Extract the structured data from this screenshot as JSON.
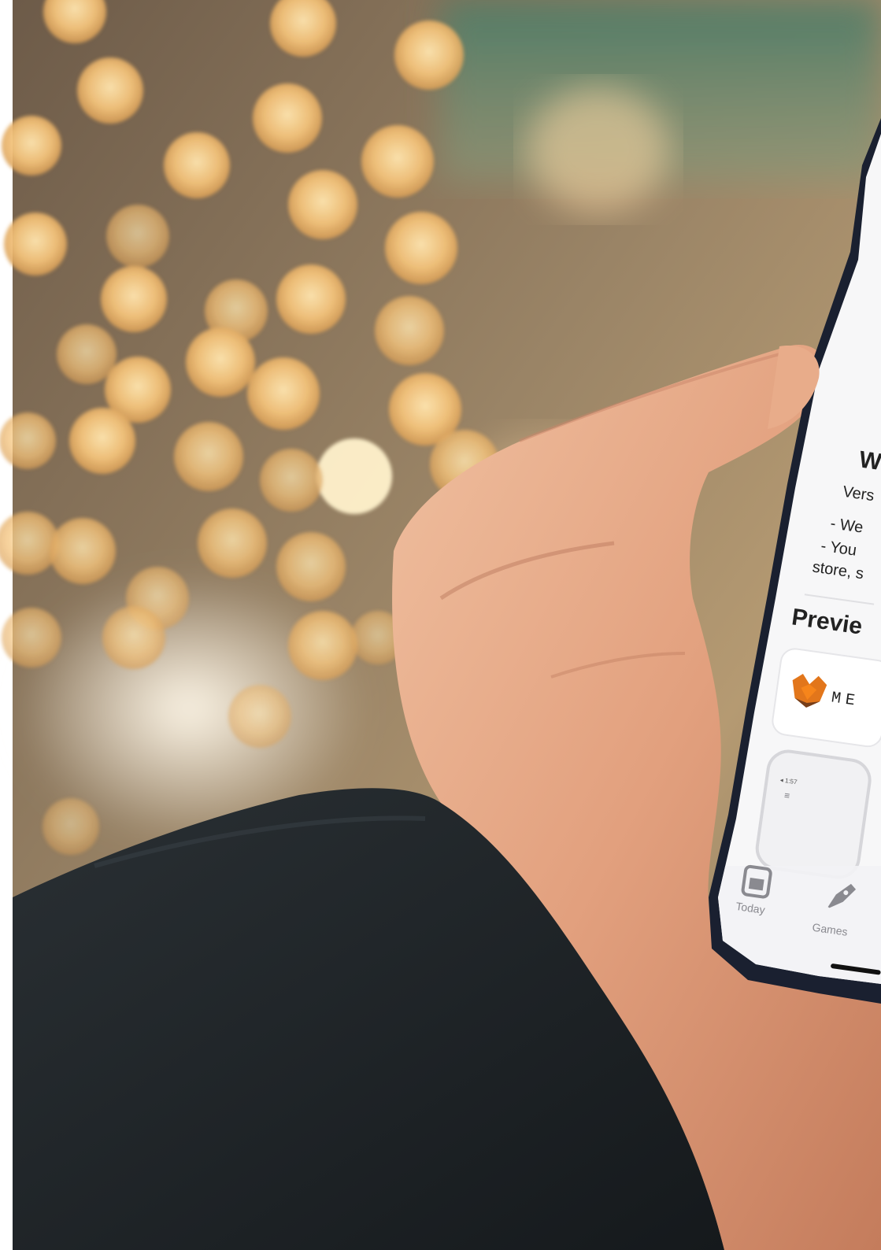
{
  "photo": {
    "subject": "hand holding smartphone showing app store page",
    "background_colors": {
      "bokeh": "#f2c27a",
      "blur_warm": "#a58a66",
      "blur_green": "#6f8f74",
      "sleeve": "#1d2327",
      "skin": "#e2a07e",
      "phone_frame": "#1a2030",
      "screen": "#f7f7f8"
    }
  },
  "screen": {
    "whats_new_heading": "W",
    "version_fragment": "Vers",
    "notes_line1": "- We",
    "notes_line2": "- You",
    "notes_line3": "store, s",
    "preview_heading": "Previe",
    "app_name_fragment": "ME",
    "status_left": "◂ 1:57"
  },
  "tab_bar": {
    "items": [
      {
        "label": "Today",
        "icon": "today-icon"
      },
      {
        "label": "Games",
        "icon": "rocket-icon"
      }
    ]
  }
}
